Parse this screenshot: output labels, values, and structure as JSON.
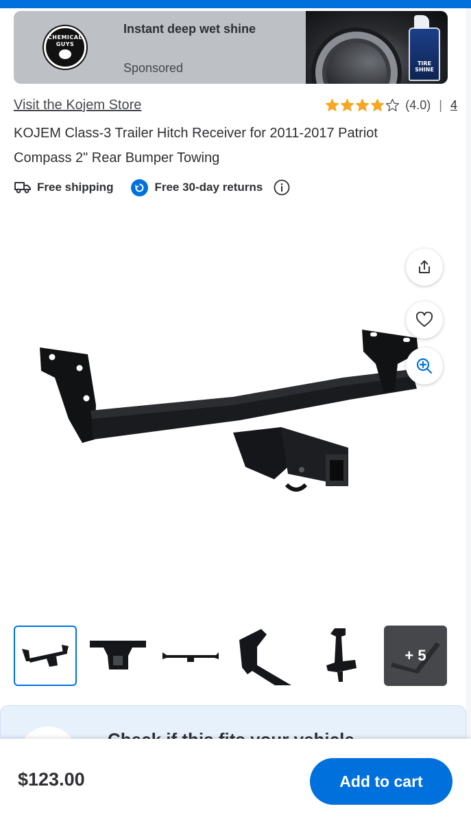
{
  "ad": {
    "brand_logo_text": "CHEMICAL GUYS",
    "title": "Instant deep wet shine",
    "sponsored_label": "Sponsored",
    "product_label": "TIRE SHINE"
  },
  "store": {
    "link_text": "Visit the Kojem Store"
  },
  "rating": {
    "stars": 4.0,
    "value_text": "(4.0)",
    "separator": "|",
    "review_count": "4"
  },
  "product": {
    "title": "KOJEM Class-3 Trailer Hitch Receiver for 2011-2017 Patriot Compass 2\" Rear Bumper Towing"
  },
  "badges": {
    "shipping": "Free shipping",
    "returns": "Free 30-day returns"
  },
  "actions": {
    "share_icon": "share-icon",
    "favorite_icon": "heart-icon",
    "zoom_icon": "zoom-in-icon"
  },
  "gallery": {
    "selected_index": 0,
    "more_label": "+ 5"
  },
  "fit_check": {
    "label": "Check if this fits your vehicle"
  },
  "cart": {
    "price": "$123.00",
    "add_label": "Add to cart"
  },
  "colors": {
    "brand_blue": "#0071dc",
    "star_gold": "#f5a623",
    "text": "#2e2f32"
  }
}
